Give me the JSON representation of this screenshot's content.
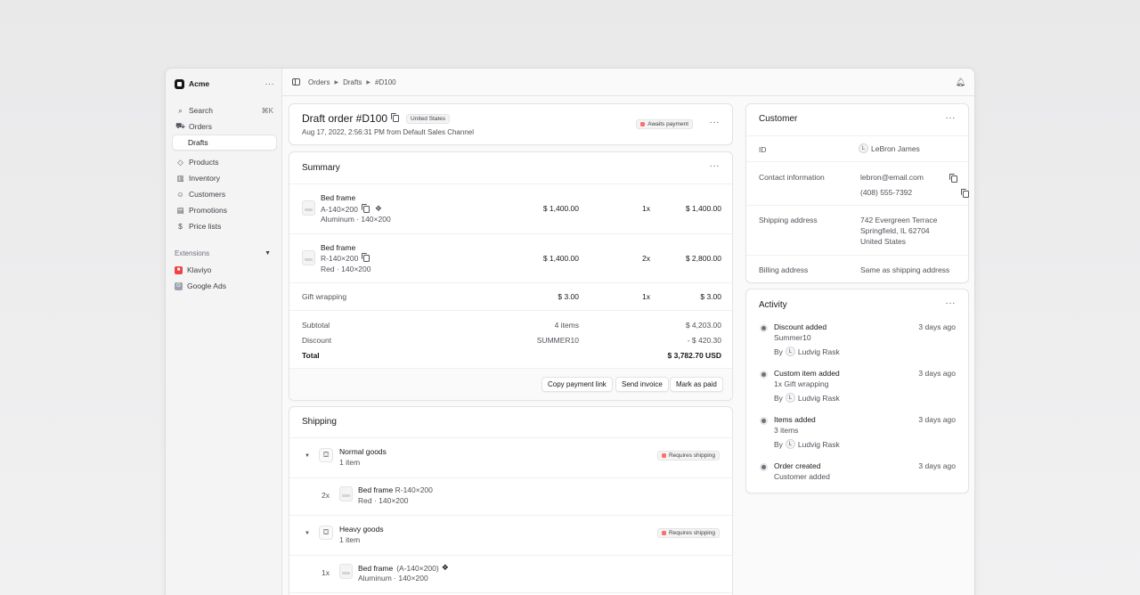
{
  "sidebar": {
    "store_name": "Acme",
    "nav": [
      {
        "label": "Search",
        "icon": "search-icon",
        "shortcut": "⌘K"
      },
      {
        "label": "Orders",
        "icon": "cart-icon"
      },
      {
        "label": "Drafts",
        "icon": ""
      },
      {
        "label": "Products",
        "icon": "tag-icon"
      },
      {
        "label": "Inventory",
        "icon": "building-icon"
      },
      {
        "label": "Customers",
        "icon": "users-icon"
      },
      {
        "label": "Promotions",
        "icon": "receipt-icon"
      },
      {
        "label": "Price lists",
        "icon": "currency-icon"
      }
    ],
    "extensions_label": "Extensions",
    "extensions": [
      {
        "label": "Klaviyo",
        "color": "#ef4444"
      },
      {
        "label": "Google Ads",
        "color": "#9ca3af"
      }
    ]
  },
  "breadcrumb": [
    "Orders",
    "Drafts",
    "#D100"
  ],
  "order": {
    "title": "Draft order #D100",
    "region": "United States",
    "status": "Awaits payment",
    "subtitle": "Aug 17, 2022, 2:56:31 PM from Default Sales Channel"
  },
  "summary": {
    "title": "Summary",
    "items": [
      {
        "name": "Bed frame",
        "sku": "A-140×200",
        "variant": "Aluminum · 140×200",
        "price": "$ 1,400.00",
        "qty": "1x",
        "total": "$ 1,400.00"
      },
      {
        "name": "Bed frame",
        "sku": "R-140×200",
        "variant": "Red · 140×200",
        "price": "$ 1,400.00",
        "qty": "2x",
        "total": "$ 2,800.00"
      }
    ],
    "custom": {
      "name": "Gift wrapping",
      "price": "$ 3.00",
      "qty": "1x",
      "total": "$ 3.00"
    },
    "subtotal_label": "Subtotal",
    "subtotal_mid": "4 items",
    "subtotal": "$ 4,203.00",
    "discount_label": "Discount",
    "discount_mid": "SUMMER10",
    "discount": "- $ 420.30",
    "total_label": "Total",
    "total": "$ 3,782.70 USD",
    "actions": [
      "Copy payment link",
      "Send invoice",
      "Mark as paid"
    ]
  },
  "shipping": {
    "title": "Shipping",
    "groups": [
      {
        "name": "Normal goods",
        "count": "1 item",
        "badge": "Requires shipping",
        "line_qty": "2x",
        "line_name": "Bed frame",
        "line_sku": "R-140×200",
        "line_variant": "Red · 140×200"
      },
      {
        "name": "Heavy goods",
        "count": "1 item",
        "badge": "Requires shipping",
        "line_qty": "1x",
        "line_name": "Bed frame",
        "line_sku": "(A-140×200)",
        "line_variant": "Aluminum · 140×200"
      }
    ]
  },
  "customer": {
    "title": "Customer",
    "id_label": "ID",
    "id_initial": "L",
    "id_name": "LeBron James",
    "contact_label": "Contact information",
    "email": "lebron@email.com",
    "phone": "(408) 555-7392",
    "shipping_label": "Shipping address",
    "address": [
      "742 Evergreen Terrace",
      "Springfield, IL 62704",
      "United States"
    ],
    "billing_label": "Billing address",
    "billing": "Same as shipping address"
  },
  "activity": {
    "title": "Activity",
    "events": [
      {
        "title": "Discount added",
        "detail": "Summer10",
        "by": "By",
        "initial": "L",
        "user": "Ludvig Rask",
        "time": "3 days ago"
      },
      {
        "title": "Custom item added",
        "detail": "1x Gift wrapping",
        "by": "By",
        "initial": "L",
        "user": "Ludvig Rask",
        "time": "3 days ago"
      },
      {
        "title": "Items added",
        "detail": "3 items",
        "by": "By",
        "initial": "L",
        "user": "Ludvig Rask",
        "time": "3 days ago"
      },
      {
        "title": "Order created",
        "detail": "Customer added",
        "time": "3 days ago"
      }
    ]
  }
}
